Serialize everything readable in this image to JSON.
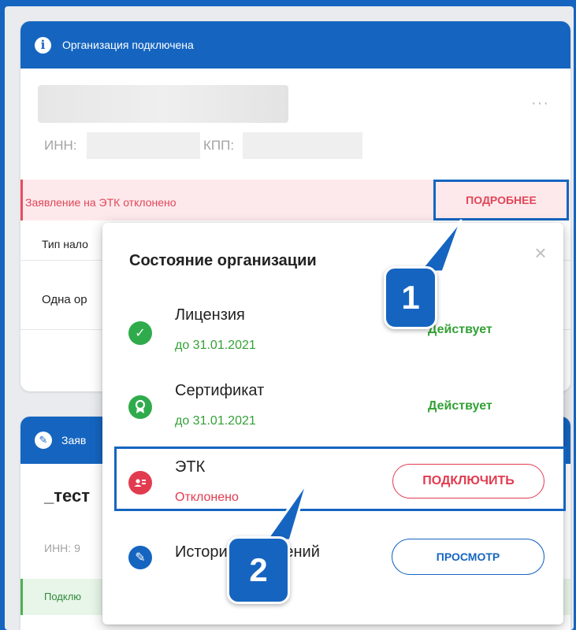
{
  "card1": {
    "header_title": "Организация подключена",
    "more_dots": "···",
    "inn_label": "ИНН:",
    "kpp_label": "КПП:",
    "alert_text": "Заявление на ЭТК отклонено",
    "more_button": "ПОДРОБНЕЕ",
    "tax_type_label": "Тип нало",
    "one_org_text": "Одна ор"
  },
  "card2": {
    "header_title": "Заяв",
    "org_name": "_тест",
    "inn_label": "ИНН: 9",
    "status_text": "Подклю"
  },
  "popup": {
    "title": "Состояние организации",
    "close_symbol": "×",
    "items": [
      {
        "name": "Лицензия",
        "sub": "до 31.01.2021",
        "status": "Действует",
        "icon": "check-icon",
        "icon_color": "#2fab4b"
      },
      {
        "name": "Сертификат",
        "sub": "до 31.01.2021",
        "status": "Действует",
        "icon": "certificate-icon",
        "icon_color": "#2fab4b"
      },
      {
        "name": "ЭТК",
        "sub": "Отклонено",
        "action": "ПОДКЛЮЧИТЬ",
        "icon": "id-card-icon",
        "icon_color": "#e23b4f"
      },
      {
        "name": "История изменений",
        "action": "ПРОСМОТР",
        "icon": "pencil-icon",
        "icon_color": "#1565c0"
      }
    ]
  },
  "callouts": {
    "one": "1",
    "two": "2"
  },
  "colors": {
    "brand_blue": "#1565c0",
    "error_red": "#e23b4f",
    "success_green": "#33a136"
  }
}
